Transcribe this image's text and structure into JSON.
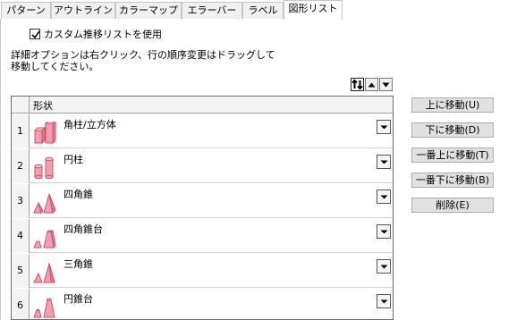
{
  "tabs": [
    {
      "label": "パターン"
    },
    {
      "label": "アウトライン"
    },
    {
      "label": "カラーマップ"
    },
    {
      "label": "エラーバー"
    },
    {
      "label": "ラベル"
    },
    {
      "label": "図形リスト"
    }
  ],
  "custom_list": {
    "label": "カスタム推移リストを使用",
    "checked": true
  },
  "info_text": "詳細オプションは右クリック、行の順序変更はドラッグして\n移動してください。",
  "sort_controls": [
    {
      "icon": "sort-toggle-icon"
    },
    {
      "icon": "arrow-up-icon"
    },
    {
      "icon": "arrow-down-icon"
    }
  ],
  "grid": {
    "header": "形状",
    "rows": [
      {
        "num": "1",
        "label": "角柱/立方体",
        "icon": "box-column-icon"
      },
      {
        "num": "2",
        "label": "円柱",
        "icon": "cylinder-icon"
      },
      {
        "num": "3",
        "label": "四角錐",
        "icon": "pyramid-icon"
      },
      {
        "num": "4",
        "label": "四角錐台",
        "icon": "pyramid-frustum-icon"
      },
      {
        "num": "5",
        "label": "三角錐",
        "icon": "triangle-pyramid-icon"
      },
      {
        "num": "6",
        "label": "円錐台",
        "icon": "cone-frustum-icon"
      }
    ]
  },
  "buttons": {
    "move_up": "上に移動(U)",
    "move_down": "下に移動(D)",
    "move_top": "一番上に移動(T)",
    "move_bottom": "一番下に移動(B)",
    "delete": "削除(E)"
  },
  "colors": {
    "shape_fill": "#f2a0b0",
    "shape_stroke": "#d0506a"
  }
}
